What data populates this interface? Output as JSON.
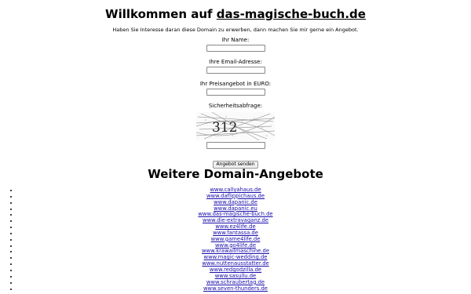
{
  "header": {
    "title_prefix": "Willkommen auf",
    "domain": "das-magische-buch.de"
  },
  "intro": "Haben Sie Interesse daran diese Domain zu erwerben, dann machen Sie mir gerne ein Angebot.",
  "form": {
    "name_label": "Ihr Name:",
    "email_label": "Ihre Email-Adresse:",
    "price_label": "Ihr Preisangebot in EURO:",
    "captcha_label": "Sicherheitsabfrage:",
    "captcha_code": "312",
    "submit_label": "Angebot senden"
  },
  "offers": {
    "title": "Weitere Domain-Angebote",
    "domains": [
      "www.callyahaus.de",
      "www.daflippichaus.de",
      "www.dapanic.de",
      "www.dapanic.eu",
      "www.das-magische-buch.de",
      "www.die-extravaganz.de",
      "www.ez4life.de",
      "www.fantassa.de",
      "www.game4life.de",
      "www.go4life.de",
      "www.krawallmaschine.de",
      "www.magic-wedding.de",
      "www.nuttenausstatter.de",
      "www.redgodzilla.de",
      "www.sasullu.de",
      "www.schraubertag.de",
      "www.seven-thunders.de"
    ]
  }
}
